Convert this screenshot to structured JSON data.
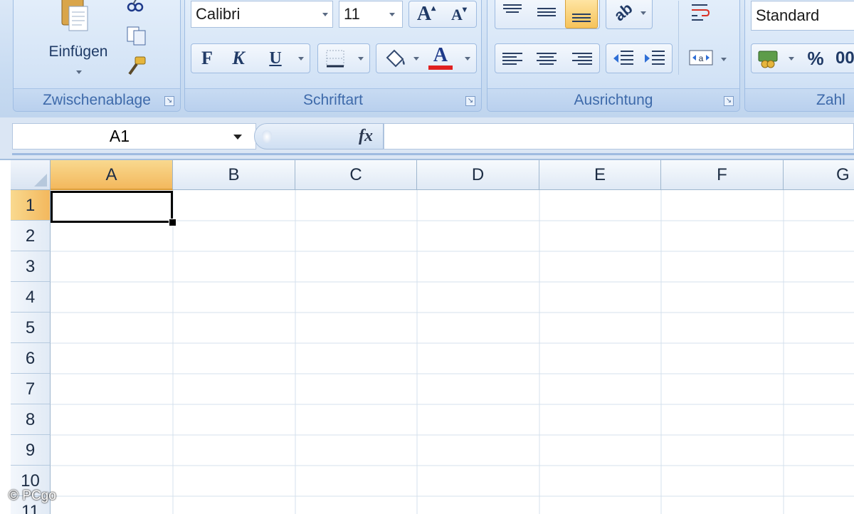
{
  "ribbon": {
    "clipboard": {
      "label": "Zwischenablage",
      "paste_label": "Einfügen"
    },
    "font": {
      "label": "Schriftart",
      "font_name": "Calibri",
      "font_size": "11",
      "bold": "F",
      "italic": "K",
      "underline": "U",
      "grow": "A",
      "shrink": "A",
      "font_color_letter": "A",
      "font_color": "#e02020"
    },
    "alignment": {
      "label": "Ausrichtung"
    },
    "number": {
      "label": "Zahl",
      "format": "Standard",
      "percent": "%",
      "thousands_partial": "00"
    }
  },
  "formula_bar": {
    "name_box": "A1",
    "fx": "fx"
  },
  "grid": {
    "columns": [
      "A",
      "B",
      "C",
      "D",
      "E",
      "F",
      "G"
    ],
    "rows": [
      "1",
      "2",
      "3",
      "4",
      "5",
      "6",
      "7",
      "8",
      "9",
      "10",
      "11"
    ],
    "selected_cell": "A1"
  },
  "watermark": "© PCgo",
  "colors": {
    "accent_selected": "#f3b85d",
    "group_label": "#3e6aaa"
  }
}
